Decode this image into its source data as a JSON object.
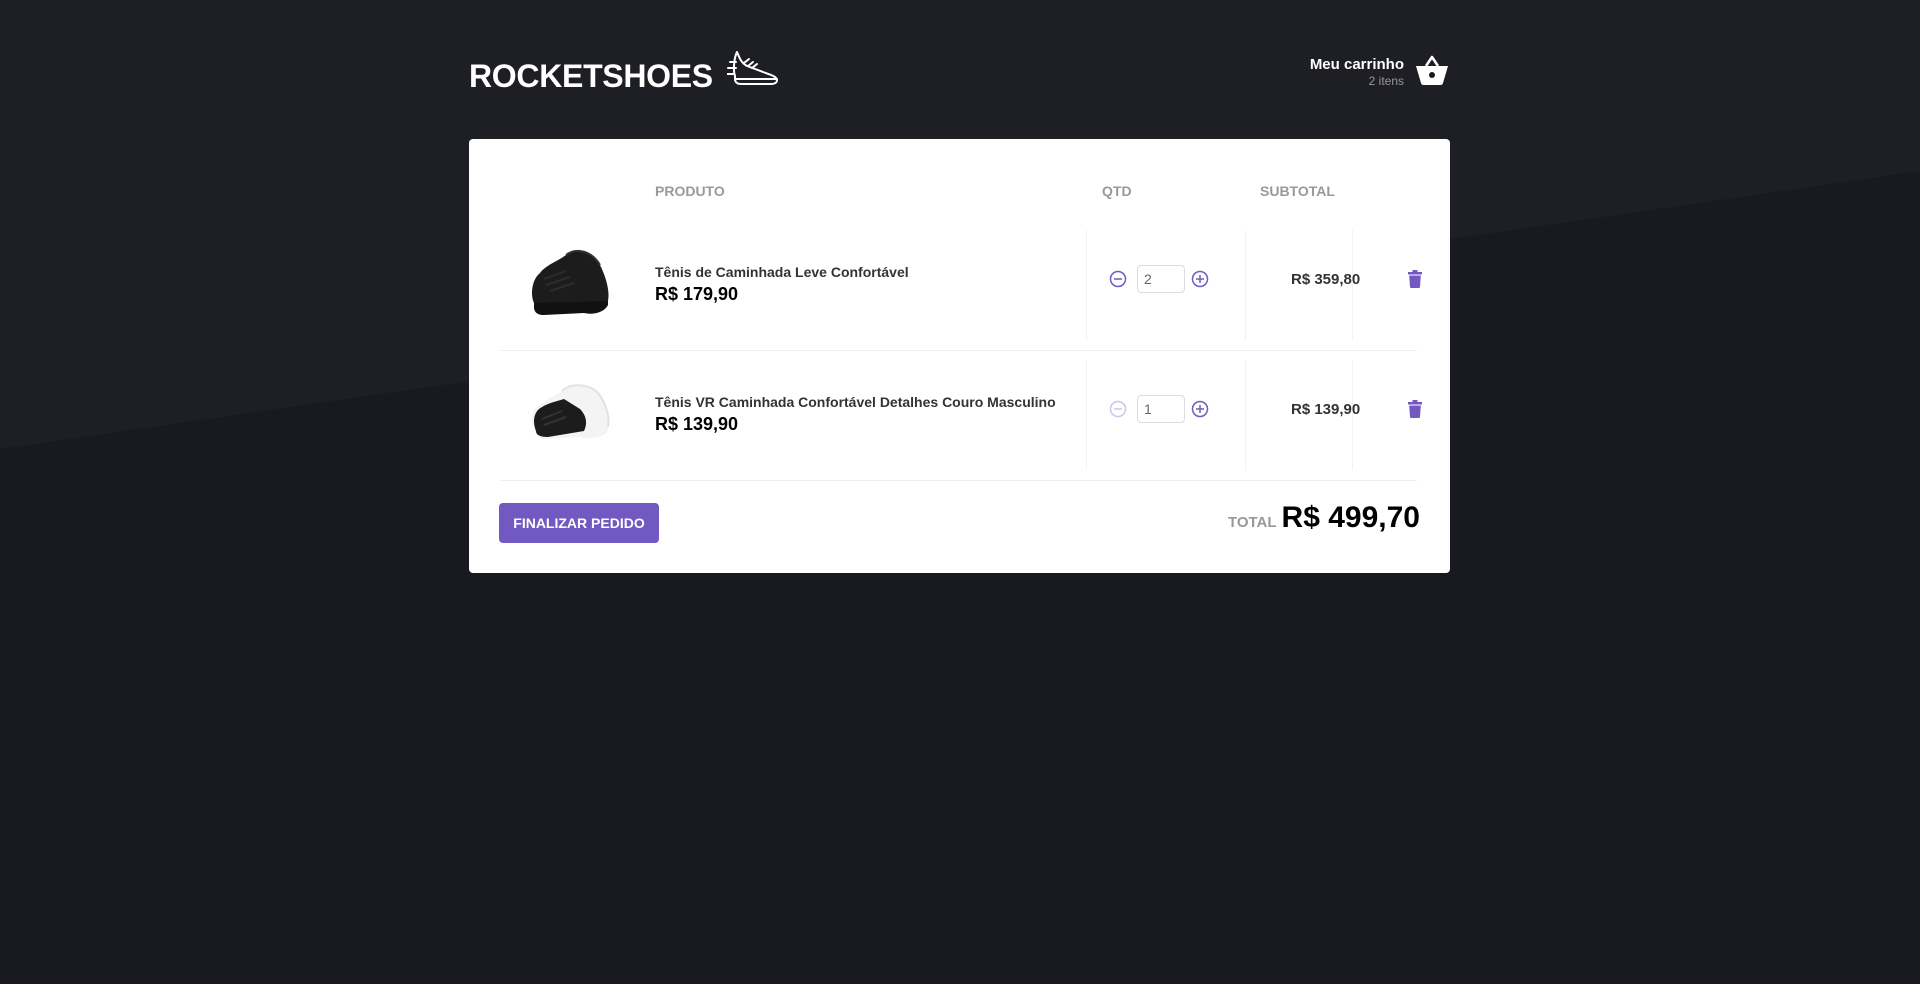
{
  "brand": {
    "name": "ROCKETSHOES",
    "logo_icon": "sneaker-icon"
  },
  "cart_link": {
    "title": "Meu carrinho",
    "count": "2 itens",
    "icon": "shopping-basket-icon"
  },
  "table": {
    "headers": {
      "product": "PRODUTO",
      "qty": "QTD",
      "subtotal": "SUBTOTAL"
    }
  },
  "items": [
    {
      "title": "Tênis de Caminhada Leve Confortável",
      "price": "R$ 179,90",
      "quantity": "2",
      "subtotal": "R$ 359,80",
      "sole_color": "#1a1a1a"
    },
    {
      "title": "Tênis VR Caminhada Confortável Detalhes Couro Masculino",
      "price": "R$ 139,90",
      "quantity": "1",
      "subtotal": "R$ 139,90",
      "sole_color": "#f4f4f4"
    }
  ],
  "footer": {
    "checkout_label": "FINALIZAR PEDIDO",
    "total_label": "TOTAL",
    "total_value": "R$ 499,70"
  },
  "colors": {
    "accent": "#7159c1",
    "background": "#191920",
    "background_diagonal": "#1d1d24",
    "panel": "#ffffff"
  }
}
